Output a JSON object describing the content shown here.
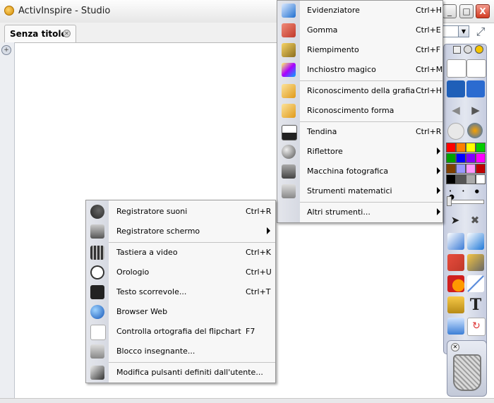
{
  "window": {
    "title": "ActivInspire - Studio",
    "tab_label": "Senza titolo",
    "controls": {
      "minimize": "_",
      "maximize": "□",
      "close": "X"
    }
  },
  "tools_menu": {
    "items": [
      {
        "label": "Evidenziatore",
        "shortcut": "Ctrl+H",
        "icon": "highlighter-icon"
      },
      {
        "label": "Gomma",
        "shortcut": "Ctrl+E",
        "icon": "eraser-icon"
      },
      {
        "label": "Riempimento",
        "shortcut": "Ctrl+F",
        "icon": "fill-bucket-icon"
      },
      {
        "label": "Inchiostro magico",
        "shortcut": "Ctrl+M",
        "icon": "magic-ink-icon"
      },
      {
        "label": "Riconoscimento della grafia",
        "shortcut": "Ctrl+H",
        "icon": "handwriting-recognition-icon"
      },
      {
        "label": "Riconoscimento forma",
        "shortcut": "",
        "icon": "shape-recognition-icon"
      },
      {
        "label": "Tendina",
        "shortcut": "Ctrl+R",
        "icon": "revealer-icon"
      },
      {
        "label": "Riflettore",
        "shortcut": "",
        "icon": "spotlight-icon",
        "submenu": true
      },
      {
        "label": "Macchina fotografica",
        "shortcut": "",
        "icon": "camera-icon",
        "submenu": true
      },
      {
        "label": "Strumenti matematici",
        "shortcut": "",
        "icon": "calculator-icon",
        "submenu": true
      },
      {
        "label": "Altri strumenti...",
        "shortcut": "",
        "icon": "",
        "submenu": true
      }
    ]
  },
  "more_tools_menu": {
    "items": [
      {
        "label": "Registratore suoni",
        "shortcut": "Ctrl+R",
        "icon": "microphone-icon"
      },
      {
        "label": "Registratore schermo",
        "shortcut": "",
        "icon": "video-camera-icon",
        "submenu": true
      },
      {
        "label": "Tastiera a video",
        "shortcut": "Ctrl+K",
        "icon": "keyboard-icon"
      },
      {
        "label": "Orologio",
        "shortcut": "Ctrl+U",
        "icon": "clock-icon"
      },
      {
        "label": "Testo scorrevole...",
        "shortcut": "Ctrl+T",
        "icon": "ticker-icon"
      },
      {
        "label": "Browser Web",
        "shortcut": "",
        "icon": "globe-icon"
      },
      {
        "label": "Controlla ortografia del flipchart",
        "shortcut": "F7",
        "icon": "spellcheck-icon"
      },
      {
        "label": "Blocco insegnante...",
        "shortcut": "",
        "icon": "teacher-lock-icon"
      },
      {
        "label": "Modifica pulsanti definiti dall'utente...",
        "shortcut": "",
        "icon": "edit-user-buttons-icon"
      }
    ]
  },
  "toolbox": {
    "text_tool": "T",
    "colors": [
      "#ff0000",
      "#ff7f00",
      "#ffff00",
      "#00cc00",
      "#00a000",
      "#0000ff",
      "#8000ff",
      "#ff00ff",
      "#804000",
      "#9999ff",
      "#ff99ff",
      "#c00000",
      "#000000",
      "#555555",
      "#aaaaaa",
      "#ffffff"
    ]
  }
}
